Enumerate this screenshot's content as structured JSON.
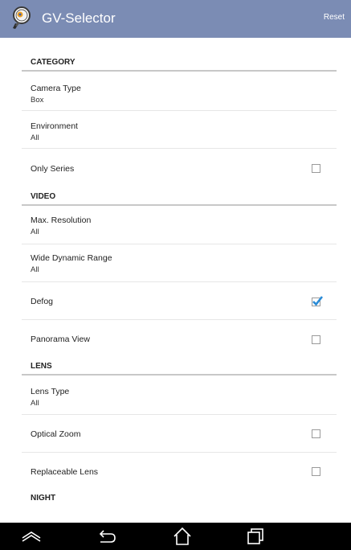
{
  "app": {
    "title": "GV-Selector",
    "icon": "magnifier-icon",
    "reset_label": "Reset",
    "action_bar_color": "#7b8cb4"
  },
  "sections": [
    {
      "header": "CATEGORY",
      "items": [
        {
          "title": "Camera Type",
          "value": "Box"
        },
        {
          "title": "Environment",
          "value": "All"
        },
        {
          "title": "Only Series",
          "checked": false
        }
      ]
    },
    {
      "header": "VIDEO",
      "items": [
        {
          "title": "Max. Resolution",
          "value": "All"
        },
        {
          "title": "Wide Dynamic Range",
          "value": "All"
        },
        {
          "title": "Defog",
          "checked": true
        },
        {
          "title": "Panorama View",
          "checked": false
        }
      ]
    },
    {
      "header": "LENS",
      "items": [
        {
          "title": "Lens Type",
          "value": "All"
        },
        {
          "title": "Optical Zoom",
          "checked": false
        },
        {
          "title": "Replaceable Lens",
          "checked": false
        }
      ]
    },
    {
      "header": "NIGHT",
      "items": []
    }
  ],
  "nav": {
    "icons": [
      "collapse-icon",
      "back-icon",
      "home-icon",
      "recent-apps-icon"
    ]
  },
  "check_color": "#2a8bd6"
}
